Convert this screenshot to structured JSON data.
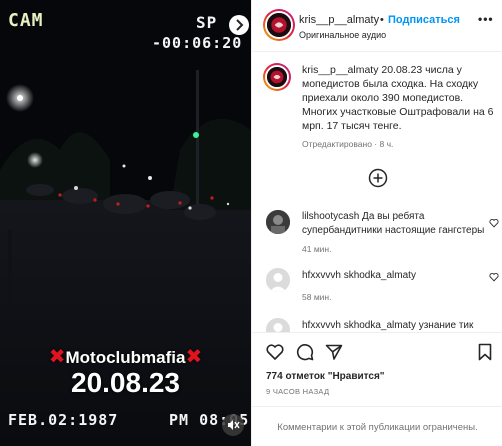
{
  "video": {
    "osd_cam": "CAM",
    "osd_sp": "SP",
    "osd_timer": "-00:06:20",
    "osd_date": "FEB.02:1987",
    "osd_pm": "PM 08:05",
    "caption_club": "Motoclubmafia",
    "caption_mark": "✖",
    "caption_date": "20.08.23"
  },
  "header": {
    "username": "kris__p__almaty",
    "dot": "•",
    "follow_label": "Подписаться",
    "audio_label": "Оригинальное аудио",
    "more_label": "•••"
  },
  "caption": {
    "username": "kris__p__almaty",
    "text": "20.08.23 числа у мопедистов была сходка. На сходку приехали около 390 мопедистов. Многих участковые Оштрафовали на 6 мрп. 17 тысяч тенге.",
    "meta": "Отредактировано · 8 ч."
  },
  "comments": [
    {
      "username": "lilshootycash",
      "text": "Да вы ребята супербандитники настоящие гангстеры",
      "time": "41 мин."
    },
    {
      "username": "hfxxvvvh",
      "text": "skhodka_almaty",
      "time": "58 мин."
    },
    {
      "username": "hfxxvvvh",
      "text": "skhodka_almaty узнание тик",
      "time": ""
    }
  ],
  "footer": {
    "likes": "774 отметок \"Нравится\"",
    "posted": "9 ЧАСОВ НАЗАД",
    "limited": "Комментарии к этой публикации ограничены."
  },
  "colors": {
    "accent": "#0095f6",
    "text": "#262626",
    "secondary": "#737373",
    "divider": "#efefef",
    "caption_red": "#e0141e"
  }
}
